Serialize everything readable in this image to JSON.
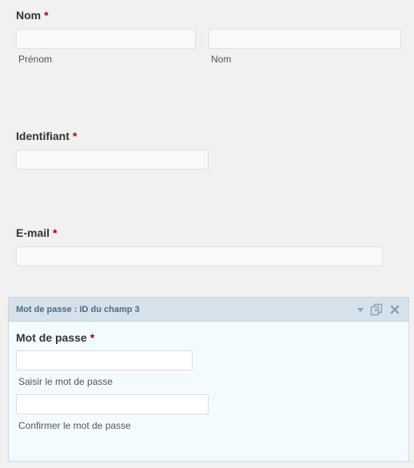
{
  "name_field": {
    "label": "Nom",
    "required_mark": "*",
    "first_sublabel": "Prénom",
    "last_sublabel": "Nom"
  },
  "username_field": {
    "label": "Identifiant",
    "required_mark": "*"
  },
  "email_field": {
    "label": "E-mail",
    "required_mark": "*"
  },
  "password_panel": {
    "header_title": "Mot de passe : ID du champ 3",
    "label": "Mot de passe",
    "required_mark": "*",
    "enter_sublabel": "Saisir le mot de passe",
    "confirm_sublabel": "Confirmer le mot de passe",
    "icons": [
      "chevron-down-icon",
      "duplicate-icon",
      "close-icon"
    ]
  }
}
